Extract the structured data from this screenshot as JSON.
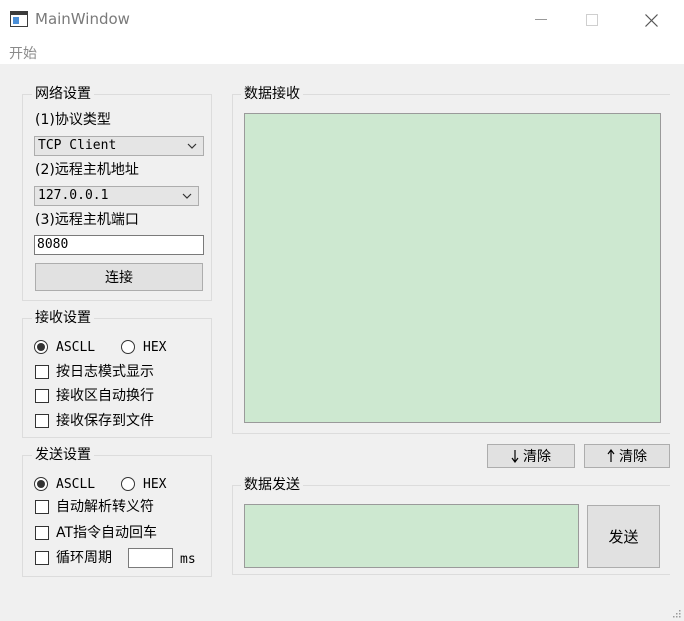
{
  "window": {
    "title": "MainWindow",
    "icon": "app-window-icon",
    "controls": [
      "minimize-icon",
      "maximize-icon",
      "close-icon"
    ]
  },
  "menubar": {
    "items": [
      {
        "label": "开始"
      }
    ]
  },
  "network": {
    "group_title": "网络设置",
    "protocol_label": "(1)协议类型",
    "protocol_value": "TCP Client",
    "host_label": "(2)远程主机地址",
    "host_value": "127.0.0.1",
    "port_label": "(3)远程主机端口",
    "port_value": "8080",
    "connect_label": "连接"
  },
  "receive_settings": {
    "group_title": "接收设置",
    "ascii_label": "ASCLL",
    "hex_label": "HEX",
    "ascii_checked": true,
    "log_mode_label": "按日志模式显示",
    "auto_wrap_label": "接收区自动换行",
    "save_file_label": "接收保存到文件"
  },
  "send_settings": {
    "group_title": "发送设置",
    "ascii_label": "ASCLL",
    "hex_label": "HEX",
    "ascii_checked": true,
    "escape_label": "自动解析转义符",
    "at_cr_label": "AT指令自动回车",
    "cycle_label": "循环周期",
    "cycle_value": "",
    "cycle_unit": "ms"
  },
  "receive_panel": {
    "group_title": "数据接收",
    "content": "",
    "background": "#cde8d0"
  },
  "buttons": {
    "clear_receive": "清除",
    "clear_send": "清除",
    "send": "发送"
  },
  "send_panel": {
    "group_title": "数据发送",
    "content": ""
  },
  "colors": {
    "text_area_bg": "#cde8d0",
    "window_bg": "#f0f0f0",
    "button_bg": "#e1e1e1"
  }
}
